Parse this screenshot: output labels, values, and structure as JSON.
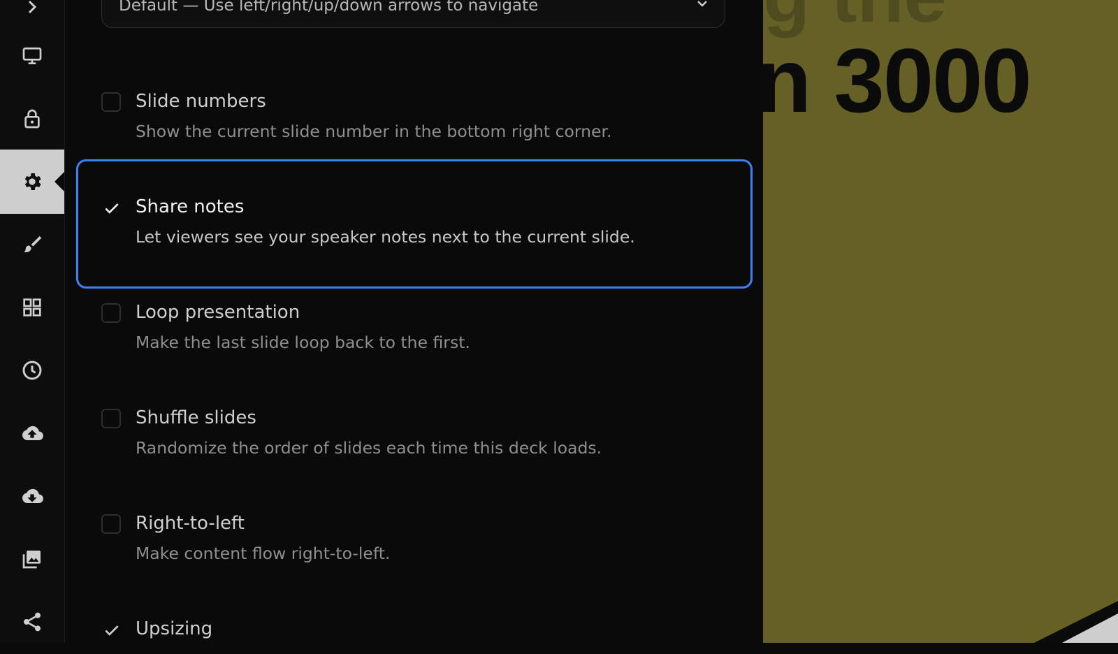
{
  "sidebar": {
    "items": [
      {
        "icon": "monitor-icon",
        "active": false
      },
      {
        "icon": "lock-icon",
        "active": false
      },
      {
        "icon": "gear-icon",
        "active": true
      },
      {
        "icon": "paintbrush-icon",
        "active": false
      },
      {
        "icon": "grid-icon",
        "active": false
      },
      {
        "icon": "clock-icon",
        "active": false
      },
      {
        "icon": "cloud-upload-icon",
        "active": false
      },
      {
        "icon": "cloud-download-icon",
        "active": false
      },
      {
        "icon": "images-icon",
        "active": false
      },
      {
        "icon": "share-icon",
        "active": false
      }
    ]
  },
  "navigation": {
    "value": "Default — Use left/right/up/down arrows to navigate"
  },
  "options": [
    {
      "title": "Slide numbers",
      "desc": "Show the current slide number in the bottom right corner.",
      "checked": false
    },
    {
      "title": "Share notes",
      "desc": "Let viewers see your speaker notes next to the current slide.",
      "checked": true
    },
    {
      "title": "Loop presentation",
      "desc": "Make the last slide loop back to the first.",
      "checked": false
    },
    {
      "title": "Shuffle slides",
      "desc": "Randomize the order of slides each time this deck loads.",
      "checked": false
    },
    {
      "title": "Right-to-left",
      "desc": "Make content flow right-to-left.",
      "checked": false
    },
    {
      "title": "Upsizing",
      "desc": "",
      "checked": true
    }
  ],
  "preview": {
    "ghost_text": "g the",
    "headline": "n 3000",
    "background_color": "#656126"
  },
  "colors": {
    "accent": "#3b82f6",
    "panel_bg": "#0a0a0b"
  }
}
